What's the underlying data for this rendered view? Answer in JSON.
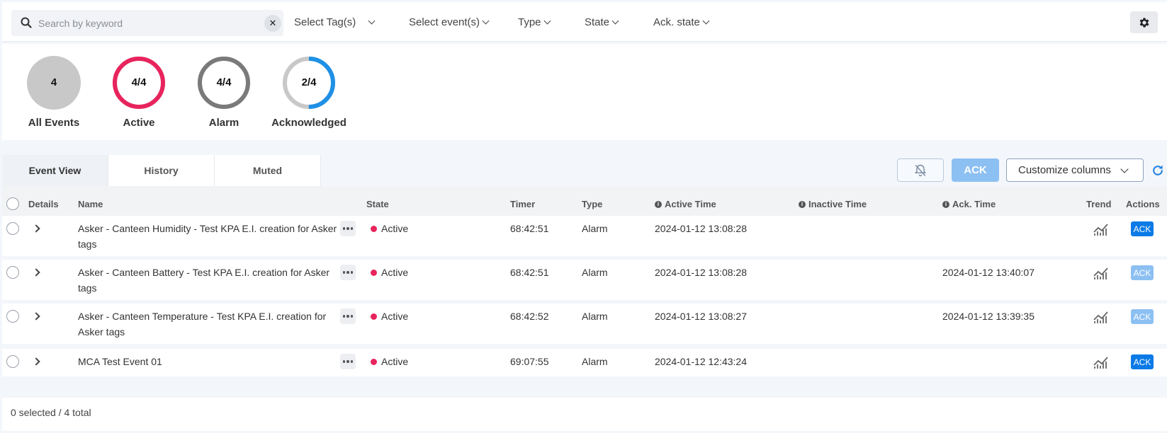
{
  "filters": {
    "search_placeholder": "Search by keyword",
    "tags": "Select Tag(s)",
    "events": "Select event(s)",
    "type": "Type",
    "state": "State",
    "ack_state": "Ack. state"
  },
  "summary": [
    {
      "value": "4",
      "label": "All Events",
      "fraction": 1.0,
      "color": "#c8c8c8",
      "style": "filled"
    },
    {
      "value": "4/4",
      "label": "Active",
      "fraction": 1.0,
      "color": "#e8245c",
      "style": "ring"
    },
    {
      "value": "4/4",
      "label": "Alarm",
      "fraction": 1.0,
      "color": "#7a7a7a",
      "style": "ring"
    },
    {
      "value": "2/4",
      "label": "Acknowledged",
      "fraction": 0.5,
      "color": "#1e90e6",
      "style": "ring"
    }
  ],
  "tabs": [
    "Event View",
    "History",
    "Muted"
  ],
  "toolbar": {
    "ack_label": "ACK",
    "customize_label": "Customize columns"
  },
  "columns": {
    "details": "Details",
    "name": "Name",
    "state": "State",
    "timer": "Timer",
    "type": "Type",
    "active_time": "Active Time",
    "inactive_time": "Inactive Time",
    "ack_time": "Ack. Time",
    "trend": "Trend",
    "actions": "Actions"
  },
  "rows": [
    {
      "name": "Asker - Canteen Humidity - Test KPA E.I. creation for Asker tags",
      "state": "Active",
      "timer": "68:42:51",
      "type": "Alarm",
      "active_time": "2024-01-12 13:08:28",
      "inactive_time": "",
      "ack_time": "",
      "action": "ACK",
      "acknowledged": false
    },
    {
      "name": "Asker - Canteen Battery - Test KPA E.I. creation for Asker tags",
      "state": "Active",
      "timer": "68:42:51",
      "type": "Alarm",
      "active_time": "2024-01-12 13:08:28",
      "inactive_time": "",
      "ack_time": "2024-01-12 13:40:07",
      "action": "ACK",
      "acknowledged": true
    },
    {
      "name": "Asker - Canteen Temperature - Test KPA E.I. creation for Asker tags",
      "state": "Active",
      "timer": "68:42:52",
      "type": "Alarm",
      "active_time": "2024-01-12 13:08:27",
      "inactive_time": "",
      "ack_time": "2024-01-12 13:39:35",
      "action": "ACK",
      "acknowledged": true
    },
    {
      "name": "MCA Test Event 01",
      "state": "Active",
      "timer": "69:07:55",
      "type": "Alarm",
      "active_time": "2024-01-12 12:43:24",
      "inactive_time": "",
      "ack_time": "",
      "action": "ACK",
      "acknowledged": false
    }
  ],
  "footer": {
    "selection": "0 selected / 4 total"
  },
  "colors": {
    "ack_active": "#0a7ae6",
    "ack_done": "#8cc0f2",
    "state_active": "#e8245c"
  }
}
